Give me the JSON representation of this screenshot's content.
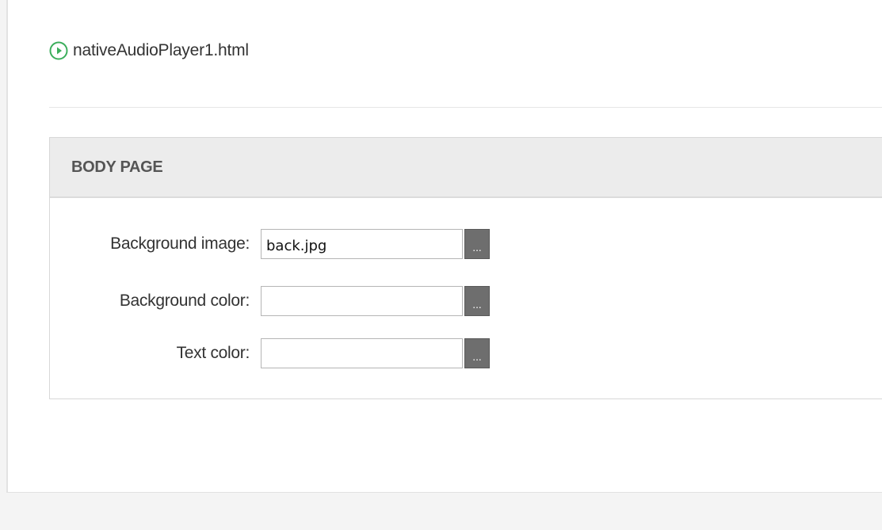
{
  "file": {
    "name": "nativeAudioPlayer1.html",
    "icon": "play-circle-icon",
    "icon_color": "#3cae5c"
  },
  "section": {
    "title": "BODY PAGE"
  },
  "fields": [
    {
      "label": "Background image:",
      "value": "back.jpg",
      "button_label": "..."
    },
    {
      "label": "Background color:",
      "value": "",
      "button_label": "..."
    },
    {
      "label": "Text color:",
      "value": "",
      "button_label": "..."
    }
  ]
}
